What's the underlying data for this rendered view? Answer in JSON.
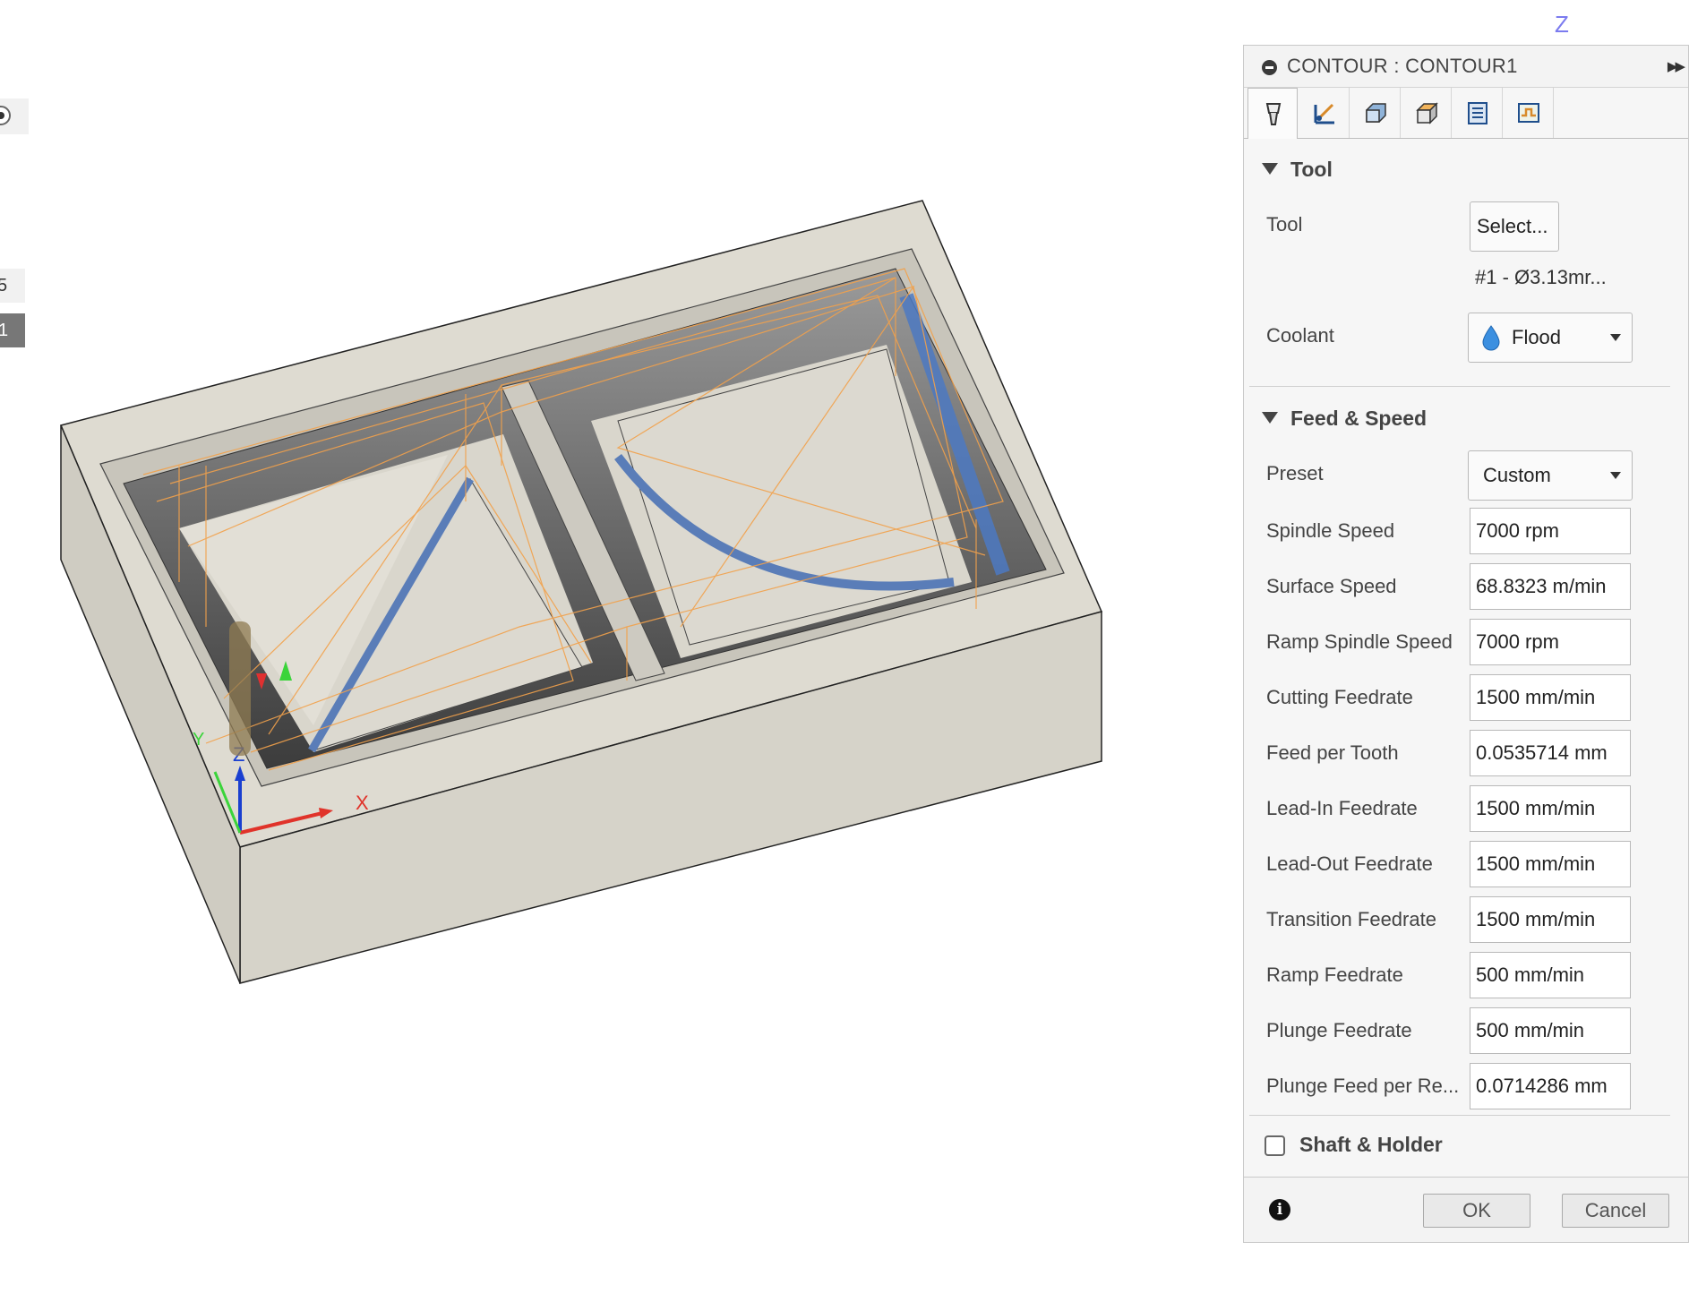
{
  "viewport": {
    "viewcube_axis": "Z",
    "triad": {
      "x": "X",
      "y": "Y",
      "z": "Z"
    },
    "left_panel": {
      "item1": "5",
      "item2": "1"
    }
  },
  "dialog": {
    "title": "CONTOUR : CONTOUR1",
    "tabs": [
      {
        "name": "tool",
        "icon": "tool-tab-icon",
        "active": true
      },
      {
        "name": "geometry",
        "icon": "geometry-tab-icon"
      },
      {
        "name": "heights",
        "icon": "heights-tab-icon"
      },
      {
        "name": "passes",
        "icon": "passes-tab-icon"
      },
      {
        "name": "linking",
        "icon": "linking-tab-icon"
      },
      {
        "name": "simulation",
        "icon": "linking-path-tab-icon"
      }
    ],
    "tool_section": {
      "heading": "Tool",
      "tool_label": "Tool",
      "select_button": "Select...",
      "tool_name": "#1 - Ø3.13mr...",
      "coolant_label": "Coolant",
      "coolant_value": "Flood",
      "coolant_icon": "water-drop-icon",
      "coolant_icon_color": "#3b8fe0"
    },
    "feed_section": {
      "heading": "Feed & Speed",
      "preset_label": "Preset",
      "preset_value": "Custom",
      "rows": [
        {
          "label": "Spindle Speed",
          "value": "7000 rpm"
        },
        {
          "label": "Surface Speed",
          "value": "68.8323 m/min"
        },
        {
          "label": "Ramp Spindle Speed",
          "value": "7000 rpm"
        },
        {
          "label": "Cutting Feedrate",
          "value": "1500 mm/min"
        },
        {
          "label": "Feed per Tooth",
          "value": "0.0535714 mm"
        },
        {
          "label": "Lead-In Feedrate",
          "value": "1500 mm/min"
        },
        {
          "label": "Lead-Out Feedrate",
          "value": "1500 mm/min"
        },
        {
          "label": "Transition Feedrate",
          "value": "1500 mm/min"
        },
        {
          "label": "Ramp Feedrate",
          "value": "500 mm/min"
        },
        {
          "label": "Plunge Feedrate",
          "value": "500 mm/min"
        },
        {
          "label": "Plunge Feed per Re...",
          "value": "0.0714286 mm"
        }
      ]
    },
    "shaft_holder": {
      "label": "Shaft & Holder",
      "checked": false
    },
    "footer": {
      "ok": "OK",
      "cancel": "Cancel"
    }
  }
}
